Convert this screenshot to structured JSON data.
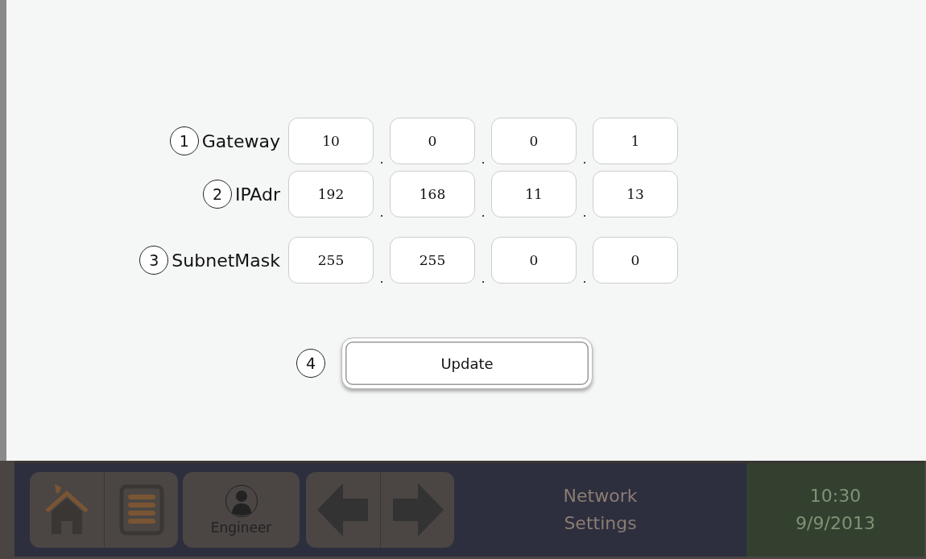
{
  "settings": [
    {
      "callout": "1",
      "label": "Gateway",
      "octets": [
        "10",
        "0",
        "0",
        "1"
      ],
      "separator": "."
    },
    {
      "callout": "2",
      "label": "IPAdr",
      "octets": [
        "192",
        "168",
        "11",
        "13"
      ],
      "separator": "."
    },
    {
      "callout": "3",
      "label": "SubnetMask",
      "octets": [
        "255",
        "255",
        "0",
        "0"
      ],
      "separator": "."
    }
  ],
  "update": {
    "callout": "4",
    "label": "Update"
  },
  "nav_bar": {
    "user": "Engineer",
    "screen_title": [
      "Network",
      "Settings"
    ],
    "time": "10:30",
    "date": "9/9/2013"
  }
}
